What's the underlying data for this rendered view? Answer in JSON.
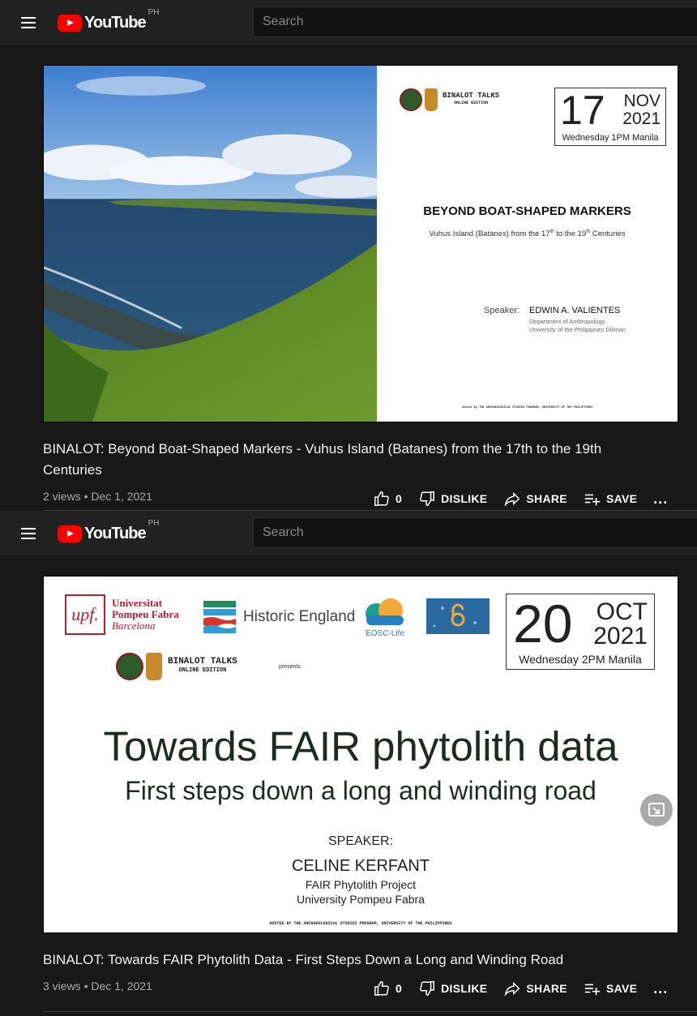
{
  "header": {
    "logo_text": "YouTube",
    "country": "PH",
    "search_placeholder": "Search"
  },
  "videos": [
    {
      "slide": {
        "series": "BINALOT TALKS",
        "series_sub": "ONLINE EDITION",
        "day": "17",
        "month": "NOV",
        "year": "2021",
        "when": "Wednesday 1PM Manila",
        "title": "BEYOND BOAT-SHAPED MARKERS",
        "subtitle_a": "Vuhus Island (Batanes) from the 17",
        "subtitle_sup1": "th",
        "subtitle_b": " to the 19",
        "subtitle_sup2": "th",
        "subtitle_c": " Centuries",
        "speaker_label": "Speaker:",
        "speaker_name": "EDWIN A. VALIENTES",
        "affil_1": "Department of Anthropology",
        "affil_2": "University of the Philippines Diliman",
        "hosted": "hosted by THE ARCHAEOLOGICAL STUDIES PROGRAM, UNIVERSITY OF THE PHILIPPINES"
      },
      "title": "BINALOT: Beyond Boat-Shaped Markers - Vuhus Island (Batanes) from the 17th to the 19th Centuries",
      "meta": "2 views • Dec 1, 2021",
      "likes": "0",
      "dislike_label": "DISLIKE",
      "share_label": "SHARE",
      "save_label": "SAVE",
      "more": "..."
    },
    {
      "slide": {
        "upf_mark": "upf.",
        "upf_line1": "Universitat",
        "upf_line2": "Pompeu Fabra",
        "upf_line3": "Barcelona",
        "historic": "Historic England",
        "eosc": "EOSC-Life",
        "day": "20",
        "month": "OCT",
        "year": "2021",
        "when": "Wednesday 2PM Manila",
        "series": "BINALOT TALKS",
        "series_sub": "ONLINE EDITION",
        "presents": "presents",
        "title": "Towards FAIR phytolith data",
        "subtitle": "First steps down a long and winding road",
        "speaker_label": "SPEAKER:",
        "speaker_name": "CELINE KERFANT",
        "affil_1": "FAIR Phytolith Project",
        "affil_2": "University Pompeu Fabra",
        "hosted": "HOSTED BY THE ARCHAEOLOGICAL STUDIES PROGRAM, UNIVERSITY OF THE PHILIPPINES"
      },
      "title": "BINALOT: Towards FAIR Phytolith Data - First Steps Down a Long and Winding Road",
      "meta": "3 views • Dec 1, 2021",
      "likes": "0",
      "dislike_label": "DISLIKE",
      "share_label": "SHARE",
      "save_label": "SAVE",
      "more": "..."
    }
  ],
  "colors": {
    "youtube_red": "#ff0000",
    "topbar": "#212121",
    "background": "#181818"
  }
}
